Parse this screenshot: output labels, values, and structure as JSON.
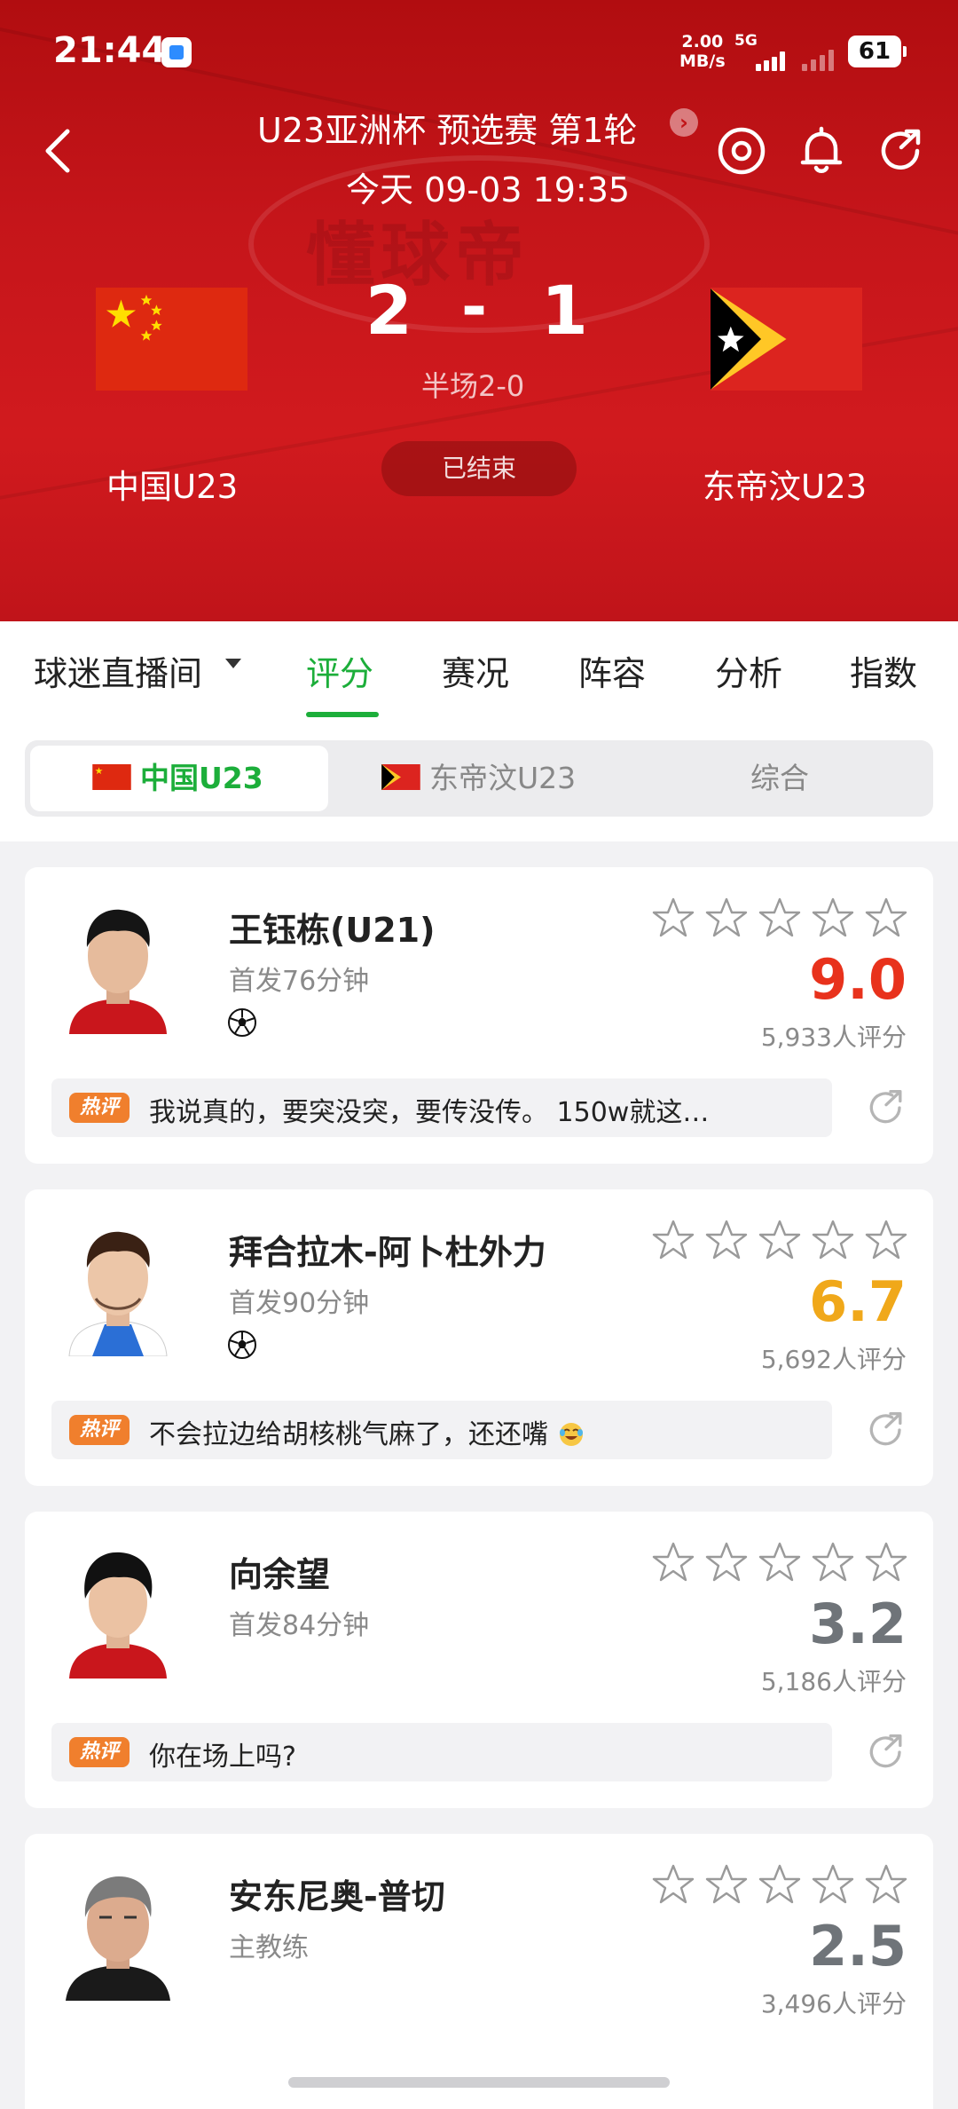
{
  "status_bar": {
    "time": "21:44",
    "speed_value": "2.00",
    "speed_unit": "MB/s",
    "network": "5G",
    "battery": "61"
  },
  "header": {
    "league": "U23亚洲杯 预选赛 第1轮",
    "datetime": "今天 09-03 19:35",
    "watermark": "懂球帝",
    "home_team": "中国U23",
    "away_team": "东帝汶U23",
    "home_score": "2",
    "away_score": "1",
    "score_sep": "-",
    "half_time": "半场2-0",
    "match_status": "已结束"
  },
  "tabs": {
    "items": [
      {
        "label": "球迷直播间"
      },
      {
        "label": "评分"
      },
      {
        "label": "赛况"
      },
      {
        "label": "阵容"
      },
      {
        "label": "分析"
      },
      {
        "label": "指数"
      }
    ],
    "active_index": 1
  },
  "segment": {
    "home": "中国U23",
    "away": "东帝汶U23",
    "all": "综合"
  },
  "players": [
    {
      "name": "王钰栋(U21)",
      "role": "首发76分钟",
      "has_goal": true,
      "score": "9.0",
      "score_color": "#e8321c",
      "votes": "5,933人评分",
      "hot_label": "热评",
      "comment": "我说真的，要突没突，要传没传。 150w就这…"
    },
    {
      "name": "拜合拉木-阿卜杜外力",
      "role": "首发90分钟",
      "has_goal": true,
      "score": "6.7",
      "score_color": "#f0a81a",
      "votes": "5,692人评分",
      "hot_label": "热评",
      "comment": "不会拉边给胡核桃气麻了，还还嘴"
    },
    {
      "name": "向余望",
      "role": "首发84分钟",
      "has_goal": false,
      "score": "3.2",
      "score_color": "#6f7479",
      "votes": "5,186人评分",
      "hot_label": "热评",
      "comment": "你在场上吗?"
    },
    {
      "name": "安东尼奥-普切",
      "role": "主教练",
      "has_goal": false,
      "score": "2.5",
      "score_color": "#6f7479",
      "votes": "3,496人评分",
      "hot_label": "",
      "comment": ""
    }
  ],
  "colors": {
    "accent": "#1cae3a",
    "header_red": "#c5151a",
    "hot_tag": "#f07f2d"
  }
}
